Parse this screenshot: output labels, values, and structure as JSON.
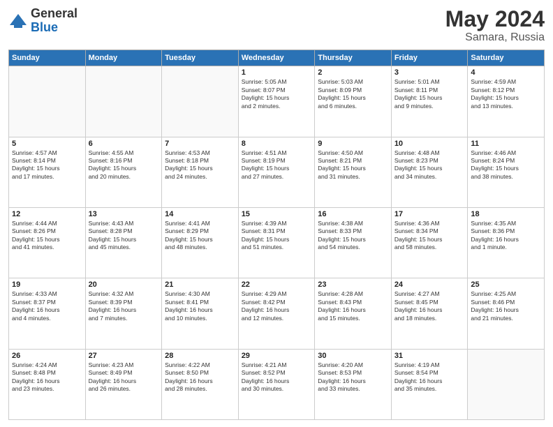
{
  "header": {
    "logo_general": "General",
    "logo_blue": "Blue",
    "month_title": "May 2024",
    "location": "Samara, Russia"
  },
  "days_of_week": [
    "Sunday",
    "Monday",
    "Tuesday",
    "Wednesday",
    "Thursday",
    "Friday",
    "Saturday"
  ],
  "weeks": [
    [
      {
        "day": "",
        "info": ""
      },
      {
        "day": "",
        "info": ""
      },
      {
        "day": "",
        "info": ""
      },
      {
        "day": "1",
        "info": "Sunrise: 5:05 AM\nSunset: 8:07 PM\nDaylight: 15 hours\nand 2 minutes."
      },
      {
        "day": "2",
        "info": "Sunrise: 5:03 AM\nSunset: 8:09 PM\nDaylight: 15 hours\nand 6 minutes."
      },
      {
        "day": "3",
        "info": "Sunrise: 5:01 AM\nSunset: 8:11 PM\nDaylight: 15 hours\nand 9 minutes."
      },
      {
        "day": "4",
        "info": "Sunrise: 4:59 AM\nSunset: 8:12 PM\nDaylight: 15 hours\nand 13 minutes."
      }
    ],
    [
      {
        "day": "5",
        "info": "Sunrise: 4:57 AM\nSunset: 8:14 PM\nDaylight: 15 hours\nand 17 minutes."
      },
      {
        "day": "6",
        "info": "Sunrise: 4:55 AM\nSunset: 8:16 PM\nDaylight: 15 hours\nand 20 minutes."
      },
      {
        "day": "7",
        "info": "Sunrise: 4:53 AM\nSunset: 8:18 PM\nDaylight: 15 hours\nand 24 minutes."
      },
      {
        "day": "8",
        "info": "Sunrise: 4:51 AM\nSunset: 8:19 PM\nDaylight: 15 hours\nand 27 minutes."
      },
      {
        "day": "9",
        "info": "Sunrise: 4:50 AM\nSunset: 8:21 PM\nDaylight: 15 hours\nand 31 minutes."
      },
      {
        "day": "10",
        "info": "Sunrise: 4:48 AM\nSunset: 8:23 PM\nDaylight: 15 hours\nand 34 minutes."
      },
      {
        "day": "11",
        "info": "Sunrise: 4:46 AM\nSunset: 8:24 PM\nDaylight: 15 hours\nand 38 minutes."
      }
    ],
    [
      {
        "day": "12",
        "info": "Sunrise: 4:44 AM\nSunset: 8:26 PM\nDaylight: 15 hours\nand 41 minutes."
      },
      {
        "day": "13",
        "info": "Sunrise: 4:43 AM\nSunset: 8:28 PM\nDaylight: 15 hours\nand 45 minutes."
      },
      {
        "day": "14",
        "info": "Sunrise: 4:41 AM\nSunset: 8:29 PM\nDaylight: 15 hours\nand 48 minutes."
      },
      {
        "day": "15",
        "info": "Sunrise: 4:39 AM\nSunset: 8:31 PM\nDaylight: 15 hours\nand 51 minutes."
      },
      {
        "day": "16",
        "info": "Sunrise: 4:38 AM\nSunset: 8:33 PM\nDaylight: 15 hours\nand 54 minutes."
      },
      {
        "day": "17",
        "info": "Sunrise: 4:36 AM\nSunset: 8:34 PM\nDaylight: 15 hours\nand 58 minutes."
      },
      {
        "day": "18",
        "info": "Sunrise: 4:35 AM\nSunset: 8:36 PM\nDaylight: 16 hours\nand 1 minute."
      }
    ],
    [
      {
        "day": "19",
        "info": "Sunrise: 4:33 AM\nSunset: 8:37 PM\nDaylight: 16 hours\nand 4 minutes."
      },
      {
        "day": "20",
        "info": "Sunrise: 4:32 AM\nSunset: 8:39 PM\nDaylight: 16 hours\nand 7 minutes."
      },
      {
        "day": "21",
        "info": "Sunrise: 4:30 AM\nSunset: 8:41 PM\nDaylight: 16 hours\nand 10 minutes."
      },
      {
        "day": "22",
        "info": "Sunrise: 4:29 AM\nSunset: 8:42 PM\nDaylight: 16 hours\nand 12 minutes."
      },
      {
        "day": "23",
        "info": "Sunrise: 4:28 AM\nSunset: 8:43 PM\nDaylight: 16 hours\nand 15 minutes."
      },
      {
        "day": "24",
        "info": "Sunrise: 4:27 AM\nSunset: 8:45 PM\nDaylight: 16 hours\nand 18 minutes."
      },
      {
        "day": "25",
        "info": "Sunrise: 4:25 AM\nSunset: 8:46 PM\nDaylight: 16 hours\nand 21 minutes."
      }
    ],
    [
      {
        "day": "26",
        "info": "Sunrise: 4:24 AM\nSunset: 8:48 PM\nDaylight: 16 hours\nand 23 minutes."
      },
      {
        "day": "27",
        "info": "Sunrise: 4:23 AM\nSunset: 8:49 PM\nDaylight: 16 hours\nand 26 minutes."
      },
      {
        "day": "28",
        "info": "Sunrise: 4:22 AM\nSunset: 8:50 PM\nDaylight: 16 hours\nand 28 minutes."
      },
      {
        "day": "29",
        "info": "Sunrise: 4:21 AM\nSunset: 8:52 PM\nDaylight: 16 hours\nand 30 minutes."
      },
      {
        "day": "30",
        "info": "Sunrise: 4:20 AM\nSunset: 8:53 PM\nDaylight: 16 hours\nand 33 minutes."
      },
      {
        "day": "31",
        "info": "Sunrise: 4:19 AM\nSunset: 8:54 PM\nDaylight: 16 hours\nand 35 minutes."
      },
      {
        "day": "",
        "info": ""
      }
    ]
  ]
}
